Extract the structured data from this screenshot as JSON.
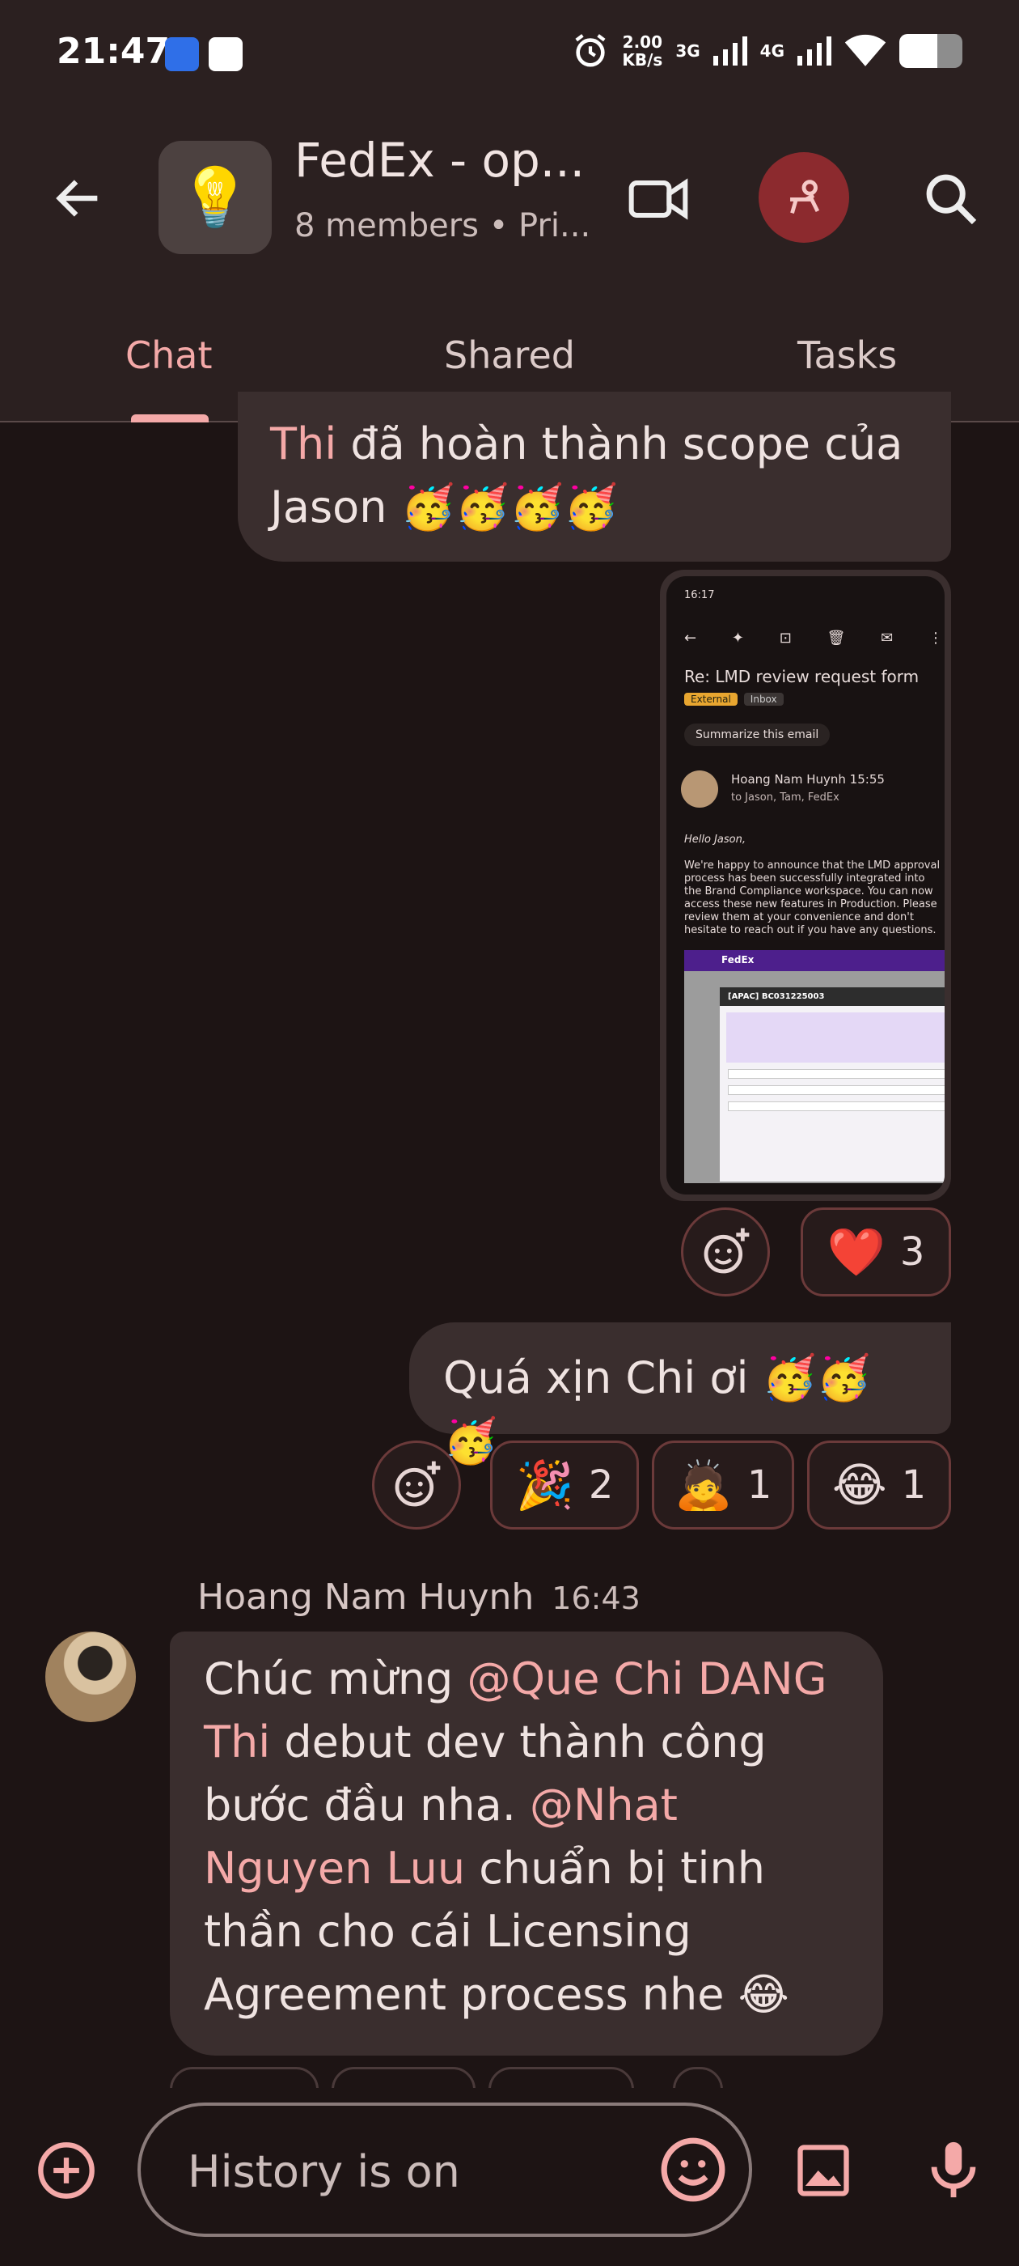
{
  "status_bar": {
    "time": "21:47",
    "speed_value": "2.00",
    "speed_unit": "KB/s",
    "net1": "3G",
    "net2": "4G"
  },
  "header": {
    "title": "FedEx - op...",
    "members": "8 members",
    "separator": "•",
    "privacy": "Pri...",
    "avatar_icon": "lightbulb-icon"
  },
  "tabs": [
    {
      "label": "Chat",
      "active": true
    },
    {
      "label": "Shared",
      "active": false
    },
    {
      "label": "Tasks",
      "active": false
    }
  ],
  "messages": {
    "top": {
      "mention": "Thi",
      "text": " đã hoàn thành scope của Jason 🥳🥳🥳🥳"
    },
    "screenshot": {
      "time": "16:17",
      "subject": "Re: LMD review request form",
      "tag_external": "External",
      "tag_inbox": "Inbox",
      "summarize": "Summarize this email",
      "sender": "Hoang Nam Huynh 15:55",
      "to": "to Jason, Tam, FedEx",
      "greeting": "Hello Jason,",
      "body": "We're happy to announce that the LMD approval process has been successfully integrated into the Brand Compliance workspace. You can now access these new features in Production. Please review them at your convenience and don't hesitate to reach out if you have any questions.",
      "fedex_logo": "FedEx",
      "form_title": "[APAC] BC031225003"
    },
    "screenshot_reactions": [
      {
        "emoji": "❤️",
        "count": "3"
      }
    ],
    "mid": {
      "text": "Quá xịn Chi ơi 🥳🥳🥳"
    },
    "mid_reactions": [
      {
        "emoji": "🎉",
        "count": "2"
      },
      {
        "emoji": "🙇",
        "count": "1"
      },
      {
        "emoji": "😂",
        "count": "1"
      }
    ],
    "incoming": {
      "sender": "Hoang Nam Huynh",
      "time": "16:43",
      "t1": "Chúc mừng ",
      "m1": "@Que Chi DANG Thi",
      "t2": " debut dev thành công bước đầu nha. ",
      "m2": "@Nhat Nguyen Luu",
      "t3": " chuẩn bị tinh thần cho cái Licensing Agreement process nhe 😂"
    }
  },
  "composer": {
    "placeholder": "History is on"
  },
  "colors": {
    "background": "#1d1414",
    "header": "#2b2020",
    "bubble": "#3a2e2e",
    "accent": "#f4a9a8",
    "huddle": "#8c2a2e"
  }
}
